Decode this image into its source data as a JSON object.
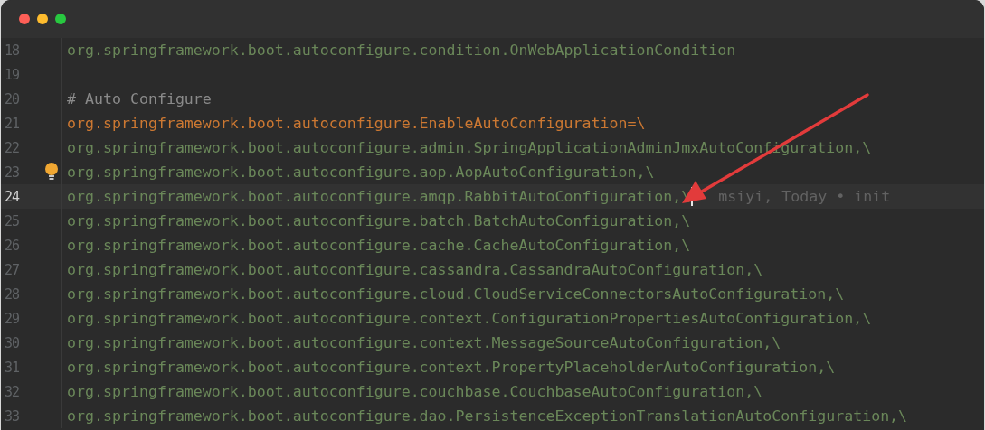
{
  "window": {
    "controls": [
      {
        "kind": "close"
      },
      {
        "kind": "minimize"
      },
      {
        "kind": "zoom"
      }
    ]
  },
  "editor": {
    "lines": [
      {
        "number": "18",
        "kind": "value",
        "text": "org.springframework.boot.autoconfigure.condition.OnWebApplicationCondition",
        "current": false,
        "bulb": false
      },
      {
        "number": "19",
        "kind": "blank",
        "current": false,
        "bulb": false
      },
      {
        "number": "20",
        "kind": "comment",
        "text": "# Auto Configure",
        "current": false,
        "bulb": false
      },
      {
        "number": "21",
        "kind": "key",
        "text": "org.springframework.boot.autoconfigure.EnableAutoConfiguration=\\",
        "current": false,
        "bulb": false
      },
      {
        "number": "22",
        "kind": "value",
        "text": "org.springframework.boot.autoconfigure.admin.SpringApplicationAdminJmxAutoConfiguration,\\",
        "current": false,
        "bulb": false
      },
      {
        "number": "23",
        "kind": "value",
        "text": "org.springframework.boot.autoconfigure.aop.AopAutoConfiguration,\\",
        "current": false,
        "bulb": true
      },
      {
        "number": "24",
        "kind": "value",
        "text": "org.springframework.boot.autoconfigure.amqp.RabbitAutoConfiguration,\\",
        "current": true,
        "bulb": false,
        "blame": "msiyi, Today • init"
      },
      {
        "number": "25",
        "kind": "value",
        "text": "org.springframework.boot.autoconfigure.batch.BatchAutoConfiguration,\\",
        "current": false,
        "bulb": false
      },
      {
        "number": "26",
        "kind": "value",
        "text": "org.springframework.boot.autoconfigure.cache.CacheAutoConfiguration,\\",
        "current": false,
        "bulb": false
      },
      {
        "number": "27",
        "kind": "value",
        "text": "org.springframework.boot.autoconfigure.cassandra.CassandraAutoConfiguration,\\",
        "current": false,
        "bulb": false
      },
      {
        "number": "28",
        "kind": "value",
        "text": "org.springframework.boot.autoconfigure.cloud.CloudServiceConnectorsAutoConfiguration,\\",
        "current": false,
        "bulb": false
      },
      {
        "number": "29",
        "kind": "value",
        "text": "org.springframework.boot.autoconfigure.context.ConfigurationPropertiesAutoConfiguration,\\",
        "current": false,
        "bulb": false
      },
      {
        "number": "30",
        "kind": "value",
        "text": "org.springframework.boot.autoconfigure.context.MessageSourceAutoConfiguration,\\",
        "current": false,
        "bulb": false
      },
      {
        "number": "31",
        "kind": "value",
        "text": "org.springframework.boot.autoconfigure.context.PropertyPlaceholderAutoConfiguration,\\",
        "current": false,
        "bulb": false
      },
      {
        "number": "32",
        "kind": "value",
        "text": "org.springframework.boot.autoconfigure.couchbase.CouchbaseAutoConfiguration,\\",
        "current": false,
        "bulb": false
      },
      {
        "number": "33",
        "kind": "value",
        "text": "org.springframework.boot.autoconfigure.dao.PersistenceExceptionTranslationAutoConfiguration,\\",
        "current": false,
        "bulb": false
      }
    ]
  },
  "annotation": {
    "kind": "arrow"
  }
}
